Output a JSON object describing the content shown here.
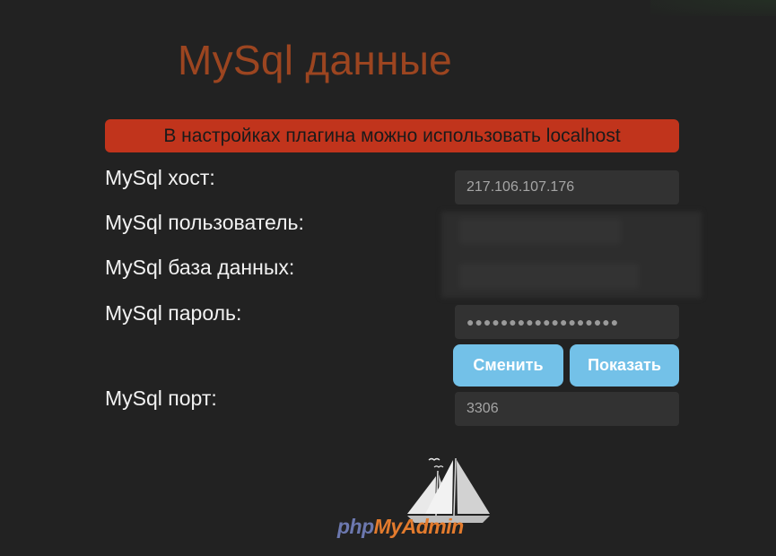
{
  "page": {
    "title": "MySql данные",
    "alert": "В настройках плагина можно использовать localhost"
  },
  "form": {
    "host_label": "MySql хост:",
    "host_value": "217.106.107.176",
    "user_label": "MySql пользователь:",
    "db_label": "MySql база данных:",
    "password_label": "MySql пароль:",
    "password_value": "●●●●●●●●●●●●●●●●●●",
    "port_label": "MySql порт:",
    "port_value": "3306"
  },
  "buttons": {
    "change": "Сменить",
    "show": "Показать"
  },
  "logo": {
    "php": "php",
    "myadmin": "MyAdmin"
  },
  "colors": {
    "background": "#222222",
    "title": "#9c4520",
    "alert_bg": "#c1341c",
    "button_bg": "#73c1e8",
    "php_blue": "#6c78af",
    "myadmin_orange": "#e37b2d"
  }
}
